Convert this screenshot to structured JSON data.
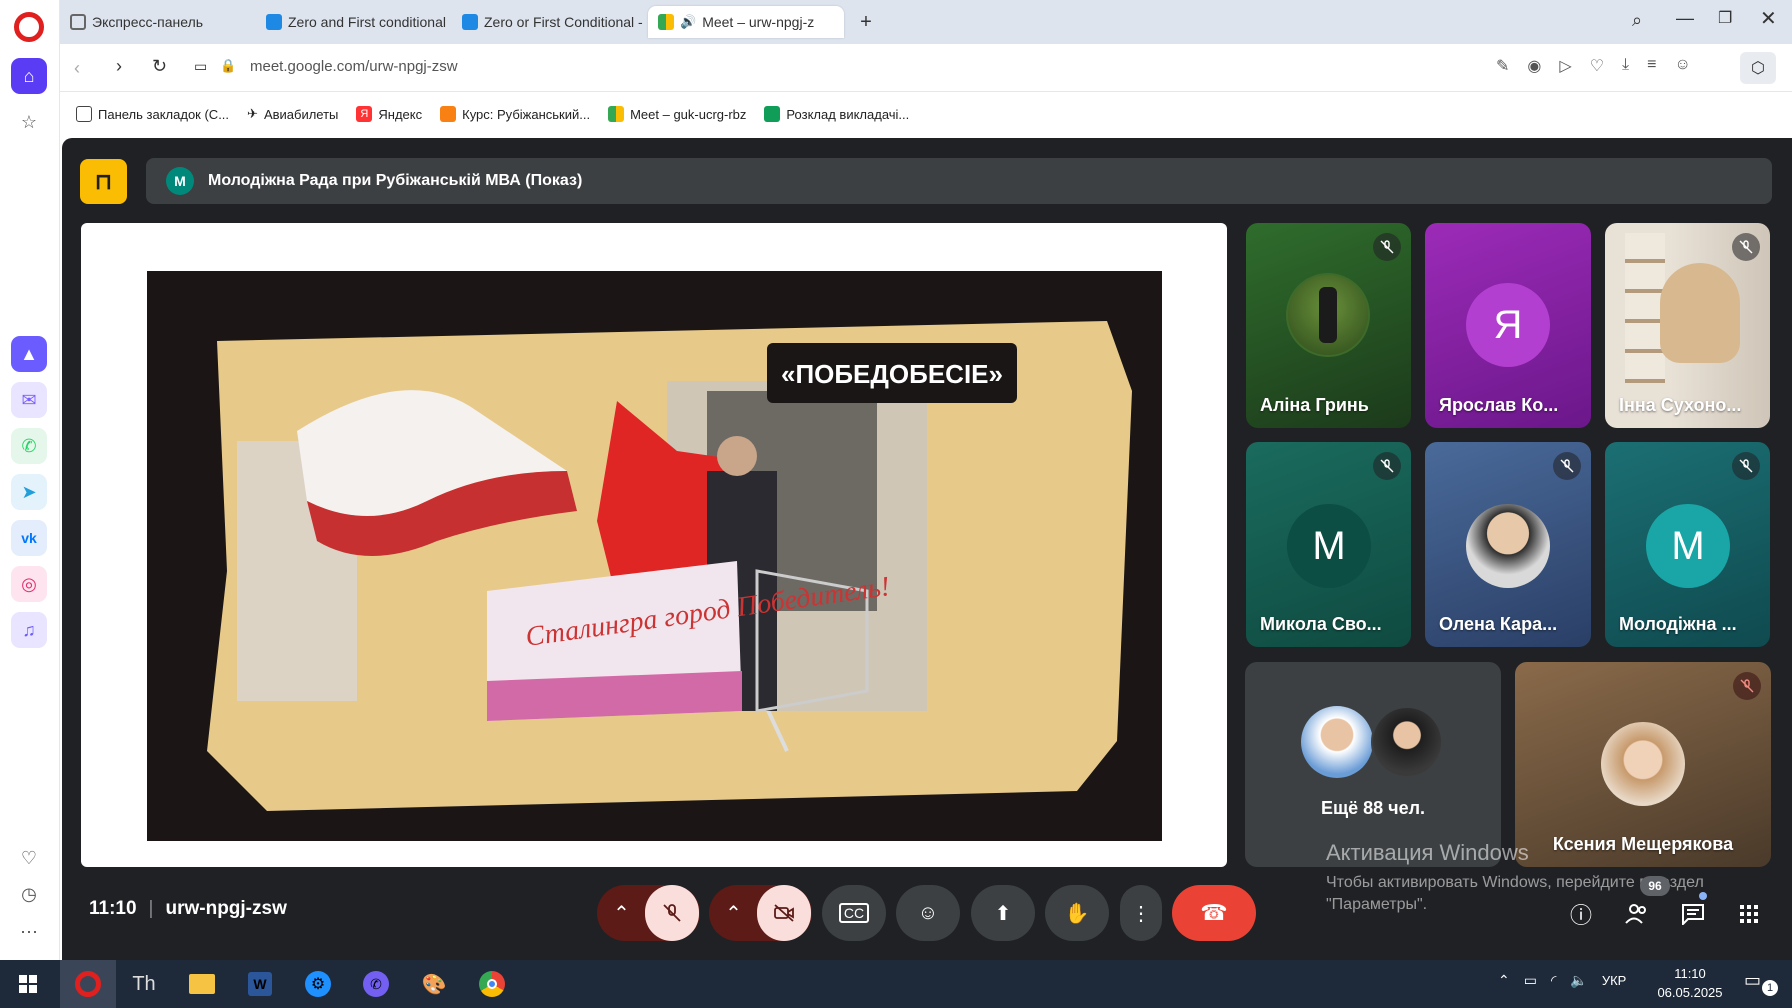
{
  "tabs": [
    {
      "label": "Экспресс-панель"
    },
    {
      "label": "Zero and First conditional"
    },
    {
      "label": "Zero or First Conditional -"
    },
    {
      "label": "Meet – urw-npgj-z"
    }
  ],
  "address": {
    "url": "meet.google.com/urw-npgj-zsw"
  },
  "bookmarks": [
    {
      "label": "Панель закладок (С..."
    },
    {
      "label": "Авиабилеты"
    },
    {
      "label": "Яндекс"
    },
    {
      "label": "Курс: Рубіжанський..."
    },
    {
      "label": "Meet – guk-ucrg-rbz"
    },
    {
      "label": "Розклад викладачі..."
    }
  ],
  "meet": {
    "presentation_title": "Молодіжна Рада при Рубіжанській МВА (Показ)",
    "presenter_avatar_letter": "М",
    "video_caption": "«ПОБЕДОБЕСІЕ»",
    "banner_text": "Сталингра город Победитель!",
    "participants": [
      {
        "name": "Аліна Гринь",
        "muted": true
      },
      {
        "name": "Ярослав Ко...",
        "letter": "Я"
      },
      {
        "name": "Інна Сухоно...",
        "muted": true
      },
      {
        "name": "Микола Сво...",
        "letter": "М",
        "muted": true
      },
      {
        "name": "Олена Кара...",
        "muted": true
      },
      {
        "name": "Молодіжна ...",
        "letter": "М",
        "muted": true
      }
    ],
    "more_participants": "Ещё 88 чел.",
    "featured": {
      "name": "Ксения Мещерякова",
      "muted": true
    },
    "time": "11:10",
    "code": "urw-npgj-zsw",
    "people_count": "96"
  },
  "watermark": {
    "title": "Активация Windows",
    "text": "Чтобы активировать Windows, перейдите в раздел \"Параметры\"."
  },
  "taskbar": {
    "lang": "УКР",
    "time": "11:10",
    "date": "06.05.2025",
    "notif_count": "1"
  }
}
